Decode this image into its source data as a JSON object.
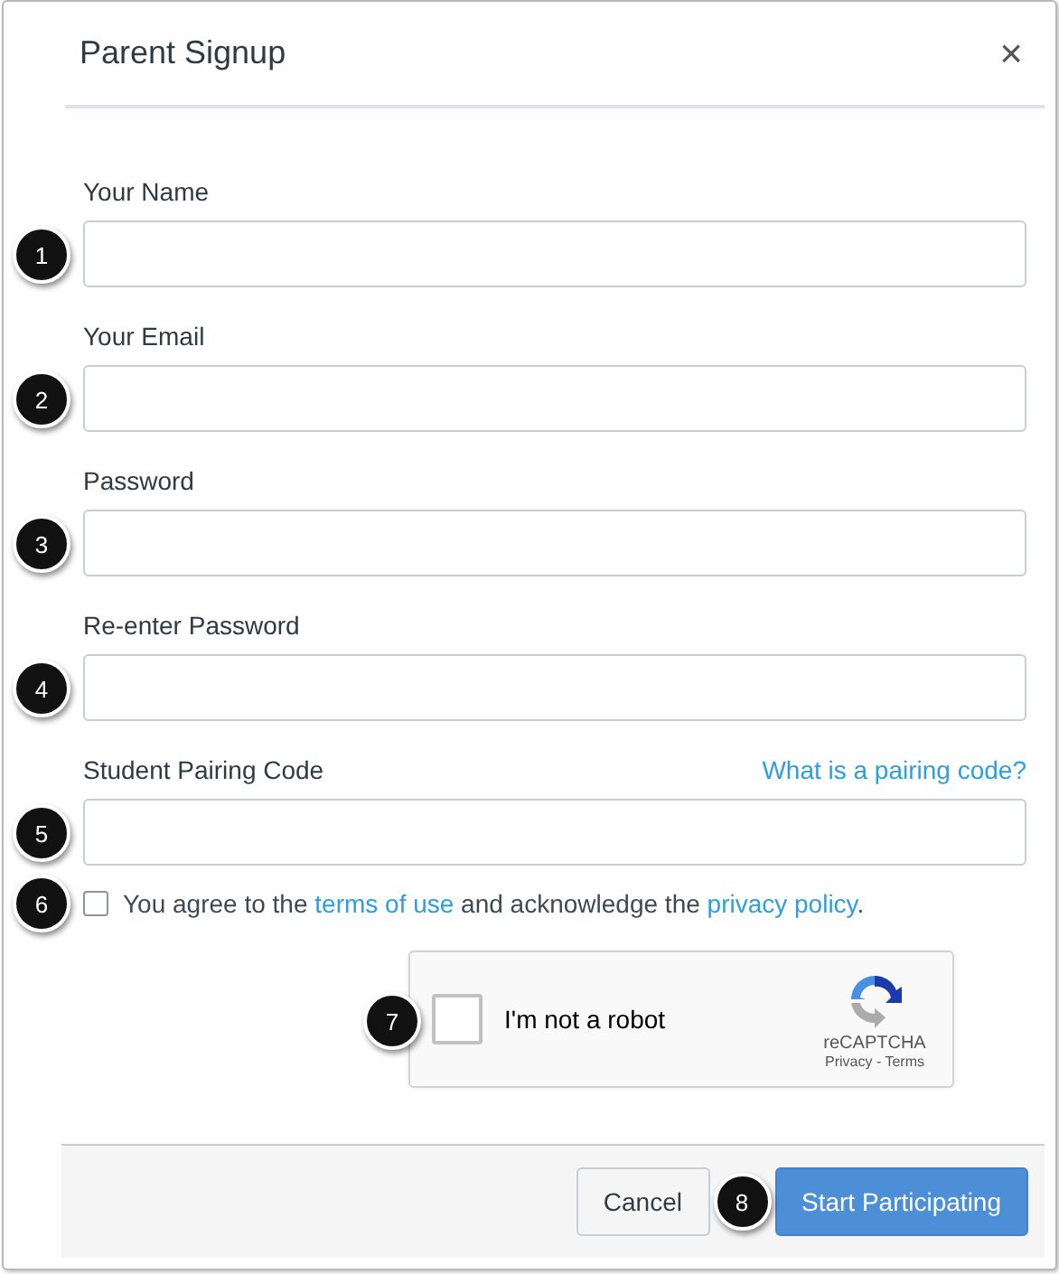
{
  "dialog": {
    "title": "Parent Signup",
    "close": "×"
  },
  "fields": [
    {
      "label": "Your Name",
      "badge": "1"
    },
    {
      "label": "Your Email",
      "badge": "2"
    },
    {
      "label": "Password",
      "badge": "3"
    },
    {
      "label": "Re-enter Password",
      "badge": "4"
    },
    {
      "label": "Student Pairing Code",
      "badge": "5",
      "help_link": "What is a pairing code?"
    }
  ],
  "agreement": {
    "checked": false,
    "badge": "6",
    "parts": [
      {
        "kind": "text",
        "text": "You agree to the "
      },
      {
        "kind": "link",
        "text": "terms of use"
      },
      {
        "kind": "text",
        "text": " and acknowledge the "
      },
      {
        "kind": "link",
        "text": "privacy policy"
      },
      {
        "kind": "text",
        "text": "."
      }
    ]
  },
  "captcha": {
    "checked": false,
    "badge": "7",
    "label": "I'm not a robot",
    "brand": "reCAPTCHA",
    "links": "Privacy - Terms"
  },
  "buttons": [
    {
      "label": "Cancel",
      "kind": "secondary"
    },
    {
      "label": "Start Participating",
      "kind": "primary",
      "badge": "8"
    }
  ]
}
